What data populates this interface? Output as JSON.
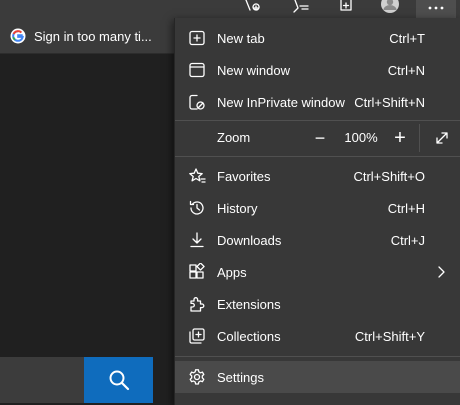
{
  "favorites_bar": {
    "items": [
      {
        "label": "Sign in too many ti...",
        "icon": "google-icon"
      }
    ]
  },
  "menu": {
    "items": [
      {
        "label": "New tab",
        "shortcut": "Ctrl+T",
        "icon": "new-tab-icon"
      },
      {
        "label": "New window",
        "shortcut": "Ctrl+N",
        "icon": "new-window-icon"
      },
      {
        "label": "New InPrivate window",
        "shortcut": "Ctrl+Shift+N",
        "icon": "inprivate-icon"
      },
      {
        "label": "Favorites",
        "shortcut": "Ctrl+Shift+O",
        "icon": "favorites-icon"
      },
      {
        "label": "History",
        "shortcut": "Ctrl+H",
        "icon": "history-icon"
      },
      {
        "label": "Downloads",
        "shortcut": "Ctrl+J",
        "icon": "download-icon"
      },
      {
        "label": "Apps",
        "shortcut": "",
        "icon": "apps-icon"
      },
      {
        "label": "Extensions",
        "shortcut": "",
        "icon": "extensions-icon"
      },
      {
        "label": "Collections",
        "shortcut": "Ctrl+Shift+Y",
        "icon": "collections-icon"
      },
      {
        "label": "Settings",
        "shortcut": "",
        "icon": "gear-icon"
      }
    ],
    "zoom": {
      "label": "Zoom",
      "value": "100%",
      "decrease": "−",
      "increase": "+"
    }
  },
  "colors": {
    "menu_bg": "#383838",
    "toolbar_bg": "#3b3b3b",
    "page_bg": "#202020",
    "accent": "#0f6cbd",
    "highlight": "#4a4a4a"
  }
}
